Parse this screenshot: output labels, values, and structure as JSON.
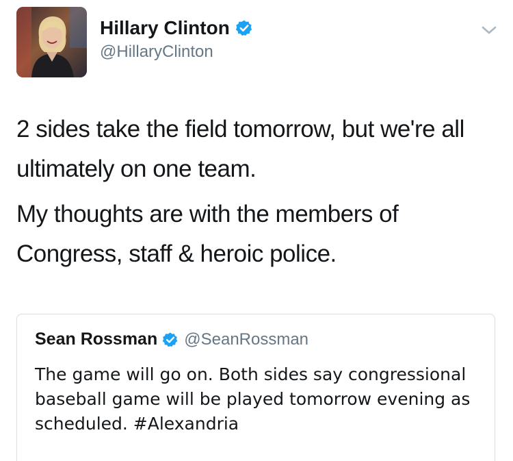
{
  "author": {
    "name": "Hillary Clinton",
    "handle": "@HillaryClinton",
    "verified": true,
    "avatar_icon": "profile-photo"
  },
  "menu_icon": "chevron-down-icon",
  "tweet": {
    "paragraphs": [
      "2 sides take the field tomorrow, but we're all ultimately on one team.",
      "My thoughts are with the members of Congress, staff & heroic police."
    ]
  },
  "quoted_tweet": {
    "name": "Sean Rossman",
    "handle": "@SeanRossman",
    "verified": true,
    "text": "The game will go on. Both sides say congressional baseball game will be played tomorrow evening as scheduled. #Alexandria"
  },
  "colors": {
    "verified_blue": "#1da1f2",
    "secondary_text": "#657786",
    "primary_text": "#14171a",
    "border": "#d8dee3"
  }
}
